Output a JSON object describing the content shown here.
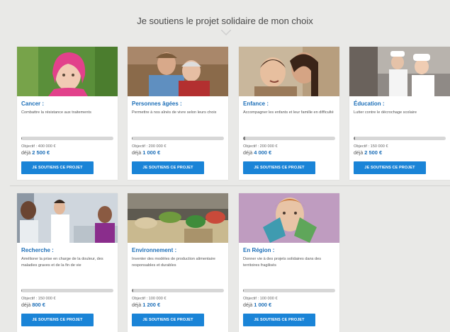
{
  "header": {
    "title": "Je soutiens le projet solidaire de mon choix"
  },
  "colors": {
    "accent": "#1a84d7",
    "title_blue": "#1d6fb8",
    "background": "#e9e9e7"
  },
  "projects": [
    {
      "title": "Cancer :",
      "description": "Combattre la résistance aux traitements",
      "goal": "Objectif : 400 000 €",
      "raised_prefix": "déjà",
      "raised": "2 500 €",
      "progress": 0.006,
      "button": "JE SOUTIENS CE PROJET",
      "image": "girl-with-pink-headscarf"
    },
    {
      "title": "Personnes âgées :",
      "description": "Permettre à nos aînés de vivre selon leurs choix",
      "goal": "Objectif : 200 000 €",
      "raised_prefix": "déjà",
      "raised": "1 000 €",
      "progress": 0.005,
      "button": "JE SOUTIENS CE PROJET",
      "image": "elderly-couple"
    },
    {
      "title": "Enfance :",
      "description": "Accompagner les enfants et leur famille en difficulté",
      "goal": "Objectif : 200 000 €",
      "raised_prefix": "déjà",
      "raised": "4 000 €",
      "progress": 0.02,
      "button": "JE SOUTIENS CE PROJET",
      "image": "mother-and-child"
    },
    {
      "title": "Éducation :",
      "description": "Lutter contre le décrochage scolaire",
      "goal": "Objectif : 150 000 €",
      "raised_prefix": "déjà",
      "raised": "2 500 €",
      "progress": 0.017,
      "button": "JE SOUTIENS CE PROJET",
      "image": "kitchen-students"
    },
    {
      "title": "Recherche :",
      "description": "Améliorer la prise en charge de la douleur, des maladies graves et de la fin de vie",
      "goal": "Objectif : 150 000 €",
      "raised_prefix": "déjà",
      "raised": "800 €",
      "progress": 0.005,
      "button": "JE SOUTIENS CE PROJET",
      "image": "medical-care"
    },
    {
      "title": "Environnement :",
      "description": "Inventer des modèles de production alimentaire responsables et durables",
      "goal": "Objectif : 100 000 €",
      "raised_prefix": "déjà",
      "raised": "1 200 €",
      "progress": 0.012,
      "button": "JE SOUTIENS CE PROJET",
      "image": "vegetable-market"
    },
    {
      "title": "En Région :",
      "description": "Donner vie à des projets solidaires dans des territoires fragilisés",
      "goal": "Objectif : 100 000 €",
      "raised_prefix": "déjà",
      "raised": "1 000 €",
      "progress": 0.01,
      "button": "JE SOUTIENS CE PROJET",
      "image": "child-painted-hands"
    }
  ]
}
